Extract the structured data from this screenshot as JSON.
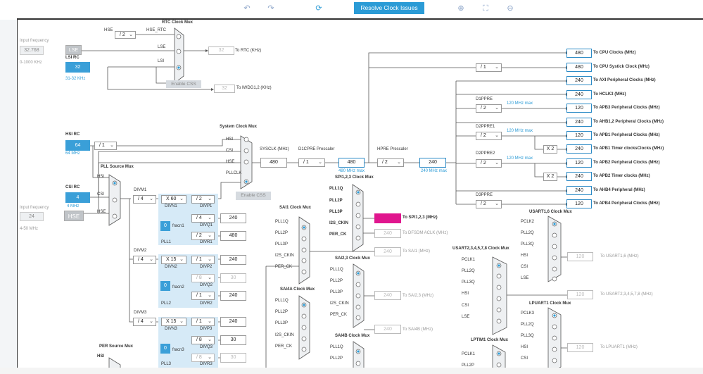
{
  "toolbar": {
    "undo_icon": "undo-icon",
    "redo_icon": "redo-icon",
    "refresh_icon": "refresh-icon",
    "resolve_label": "Resolve Clock Issues",
    "zoom_in_icon": "zoom-in-icon",
    "fit_icon": "fit-icon",
    "zoom_out_icon": "zoom-out-icon"
  },
  "lse": {
    "input_frequency_label": "Input frequency",
    "input_value": "32.768",
    "range": "0-1000 KHz",
    "button": "LSE"
  },
  "lsirc": {
    "title": "LSI RC",
    "value": "32",
    "freq": "31-32 KHz"
  },
  "hsirc": {
    "title": "HSI RC",
    "value": "64",
    "freq": "64 MHz",
    "divider": "/ 1"
  },
  "csirc": {
    "title": "CSI RC",
    "value": "4",
    "freq": "4 MHz"
  },
  "hse": {
    "input_frequency_label": "Input frequency",
    "input_value": "24",
    "range": "4-50 MHz",
    "button": "HSE"
  },
  "rtc": {
    "mux_title": "RTC Clock Mux",
    "hse_label": "HSE",
    "hse_div": "/ 2",
    "hse_rtc_label": "HSE_RTC",
    "lse_label": "LSE",
    "lsi_label": "LSI",
    "out_value": "32",
    "out_label": "To RTC (KHz)",
    "enable_css": "Enable CSS",
    "iwdg_value": "32",
    "iwdg_label": "To IWDG1,2 (KHz)"
  },
  "sysclk_mux": {
    "title": "System Clock Mux",
    "hsi": "HSI",
    "csi": "CSI",
    "hse": "HSE",
    "pllclk": "PLLCLK",
    "enable_css": "Enable CSS"
  },
  "pll_src": {
    "title": "PLL Source Mux",
    "hsi": "HSI",
    "csi": "CSI",
    "hse": "HSE"
  },
  "sysclk": {
    "label": "SYSCLK (MHz)",
    "value": "480",
    "d1cpre_label": "D1CPRE Prescaler",
    "d1cpre": "/ 1",
    "d1cpre_out": "480",
    "d1cpre_max": "480 MHz max",
    "hpre_label": "HPRE Prescaler",
    "hpre": "/ 2",
    "hpre_out": "240",
    "hpre_max": "240 MHz max"
  },
  "outputs": [
    {
      "value": "480",
      "label": "To CPU Clocks (MHz)"
    },
    {
      "value": "480",
      "label": "To CPU Systick Clock (MHz)",
      "div": "/ 1"
    },
    {
      "value": "240",
      "label": "To AXI Peripheral Clocks (MHz)"
    },
    {
      "value": "240",
      "label": "To HCLK3 (MHz)"
    },
    {
      "value": "120",
      "label": "To APB3 Peripheral Clocks (MHz)",
      "prescaler": "D1PPRE",
      "div": "/ 2",
      "max": "120 MHz max"
    },
    {
      "value": "240",
      "label": "To AHB1,2 Peripheral Clocks (MHz)"
    },
    {
      "value": "120",
      "label": "To APB1 Peripheral Clocks (MHz)",
      "prescaler": "D2PPRE1",
      "div": "/ 2",
      "max": "120 MHz max"
    },
    {
      "value": "240",
      "label": "To APB1 Timer clocksClocks (MHz)",
      "mult": "X 2"
    },
    {
      "value": "120",
      "label": "To APB2 Peripheral Clocks (MHz)",
      "prescaler": "D2PPRE2",
      "div": "/ 2",
      "max": "120 MHz max"
    },
    {
      "value": "240",
      "label": "To APB2 Timer clocks (MHz)",
      "mult": "X 2"
    },
    {
      "value": "240",
      "label": "To AHB4 Peripheral (MHz)"
    },
    {
      "value": "120",
      "label": "To APB4 Peripheral Clocks (MHz)",
      "prescaler": "D3PPRE",
      "div": "/ 2"
    }
  ],
  "pll1": {
    "divm_label": "DIVM1",
    "divm": "/ 4",
    "divn": "X 60",
    "divn_label": "DIVN1",
    "divp": "/ 2",
    "divp_label": "DIVP1",
    "divq": "/ 4",
    "divq_label": "DIVQ1",
    "divq_out": "240",
    "divr": "/ 2",
    "divr_label": "DIVR1",
    "divr_out": "480",
    "fracn": "0",
    "fracn_label": "fracn1",
    "name": "PLL1"
  },
  "pll2": {
    "divm_label": "DIVM2",
    "divm": "/ 4",
    "divn": "X 15",
    "divn_label": "DIVN2",
    "divp": "/ 1",
    "divp_label": "DIVP2",
    "divp_out": "240",
    "divq": "/ 8",
    "divq_label": "DIVQ2",
    "divq_out": "30",
    "divr": "/ 1",
    "divr_label": "DIVR2",
    "divr_out": "240",
    "fracn": "0",
    "fracn_label": "fracn2",
    "name": "PLL2"
  },
  "pll3": {
    "divm_label": "DIVM3",
    "divm": "/ 4",
    "divn": "X 15",
    "divn_label": "DIVN3",
    "divp": "/ 1",
    "divp_label": "DIVP3",
    "divp_out": "240",
    "divq": "/ 8",
    "divq_label": "DIVQ3",
    "divq_out": "30",
    "divr": "/ 8",
    "divr_label": "DIVR3",
    "divr_out": "30",
    "fracn": "0",
    "fracn_label": "fracn3",
    "name": "PLL3"
  },
  "per_mux": {
    "title": "PER Source Mux",
    "hsi": "HSI"
  },
  "sai1": {
    "title": "SAI1 Clock Mux",
    "in": [
      "PLL1Q",
      "PLL2P",
      "PLL3P",
      "I2S_CKIN",
      "PER_CK"
    ]
  },
  "spi123": {
    "title": "SPI1,2,3 Clock Mux",
    "in": [
      "PLL1Q",
      "PLL2P",
      "PLL3P",
      "I2S_CKIN",
      "PER_CK"
    ],
    "out_label": "To SPI1,2,3 (MHz)",
    "dfsdm_value": "240",
    "dfsdm_label": "To DFSDM ACLK (MHz)",
    "sai1_value": "240",
    "sai1_label": "To SAI1 (MHz)"
  },
  "sai23": {
    "title": "SAI2,3 Clock Mux",
    "in": [
      "PLL1Q",
      "PLL2P",
      "PLL3P",
      "I2S_CKIN",
      "PER_CK"
    ],
    "value": "240",
    "label": "To SAI2,3 (MHz)"
  },
  "sai4a": {
    "title": "SAI4A Clock Mux",
    "in": [
      "PLL1Q",
      "PLL2P",
      "PLL3P",
      "I2S_CKIN",
      "PER_CK"
    ]
  },
  "sai4b": {
    "title": "SAI4B Clock Mux",
    "in": [
      "PLL1Q",
      "PLL2P"
    ],
    "value": "240",
    "label": "To SAI4B (MHz)"
  },
  "usart16": {
    "title": "USART1,6 Clock Mux",
    "in": [
      "PCLK2",
      "PLL2Q",
      "PLL3Q",
      "HSI",
      "CSI",
      "LSE"
    ],
    "value": "120",
    "label": "To USART1,6 (MHz)"
  },
  "usart2": {
    "title": "USART2,3,4,5,7,8 Clock Mux",
    "in": [
      "PCLK1",
      "PLL2Q",
      "PLL3Q",
      "HSI",
      "CSI",
      "LSE"
    ],
    "value": "120",
    "label": "To USART2,3,4,5,7,8 (MHz)"
  },
  "lpuart1": {
    "title": "LPUART1 Clock Mux",
    "in": [
      "PCLK3",
      "PLL2Q",
      "PLL3Q",
      "HSI",
      "CSI"
    ],
    "value": "120",
    "label": "To LPUART1 (MHz)"
  },
  "lptim1": {
    "title": "LPTIM1 Clock Mux",
    "in": [
      "PCLK1",
      "PLL2P"
    ]
  }
}
